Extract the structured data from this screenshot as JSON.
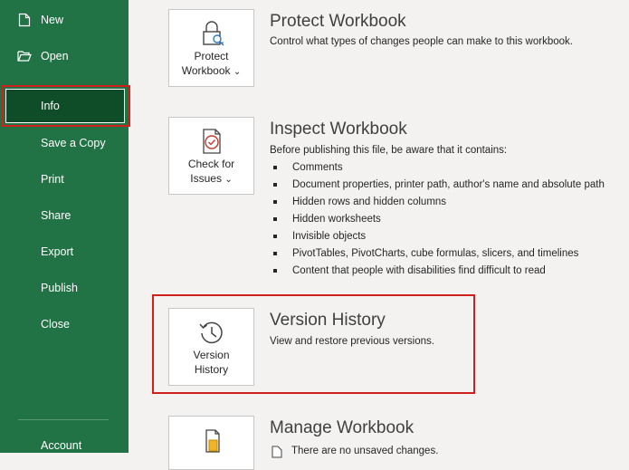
{
  "sidebar": {
    "items": [
      {
        "label": "New",
        "icon": "new-document-icon"
      },
      {
        "label": "Open",
        "icon": "open-folder-icon"
      },
      {
        "label": "Info",
        "selected": true
      },
      {
        "label": "Save a Copy"
      },
      {
        "label": "Print"
      },
      {
        "label": "Share"
      },
      {
        "label": "Export"
      },
      {
        "label": "Publish"
      },
      {
        "label": "Close"
      },
      {
        "label": "Account"
      }
    ]
  },
  "sections": {
    "protect": {
      "tile_line1": "Protect",
      "tile_line2": "Workbook",
      "chevron": "⌄",
      "title": "Protect Workbook",
      "description": "Control what types of changes people can make to this workbook.",
      "icon": "padlock-key-icon"
    },
    "inspect": {
      "tile_line1": "Check for",
      "tile_line2": "Issues",
      "chevron": "⌄",
      "title": "Inspect Workbook",
      "description": "Before publishing this file, be aware that it contains:",
      "icon": "check-document-icon",
      "bullets": [
        "Comments",
        "Document properties, printer path, author's name and absolute path",
        "Hidden rows and hidden columns",
        "Hidden worksheets",
        "Invisible objects",
        "PivotTables, PivotCharts, cube formulas, slicers, and timelines",
        "Content that people with disabilities find difficult to read"
      ]
    },
    "version": {
      "tile_line1": "Version",
      "tile_line2": "History",
      "title": "Version History",
      "description": "View and restore previous versions.",
      "icon": "history-clock-icon"
    },
    "manage": {
      "title": "Manage Workbook",
      "description": "There are no unsaved changes.",
      "icon": "manage-workbook-icon"
    }
  },
  "colors": {
    "sidebar": "#217346",
    "sidebar_selected": "#0e4d27",
    "highlight": "#d0201c"
  }
}
